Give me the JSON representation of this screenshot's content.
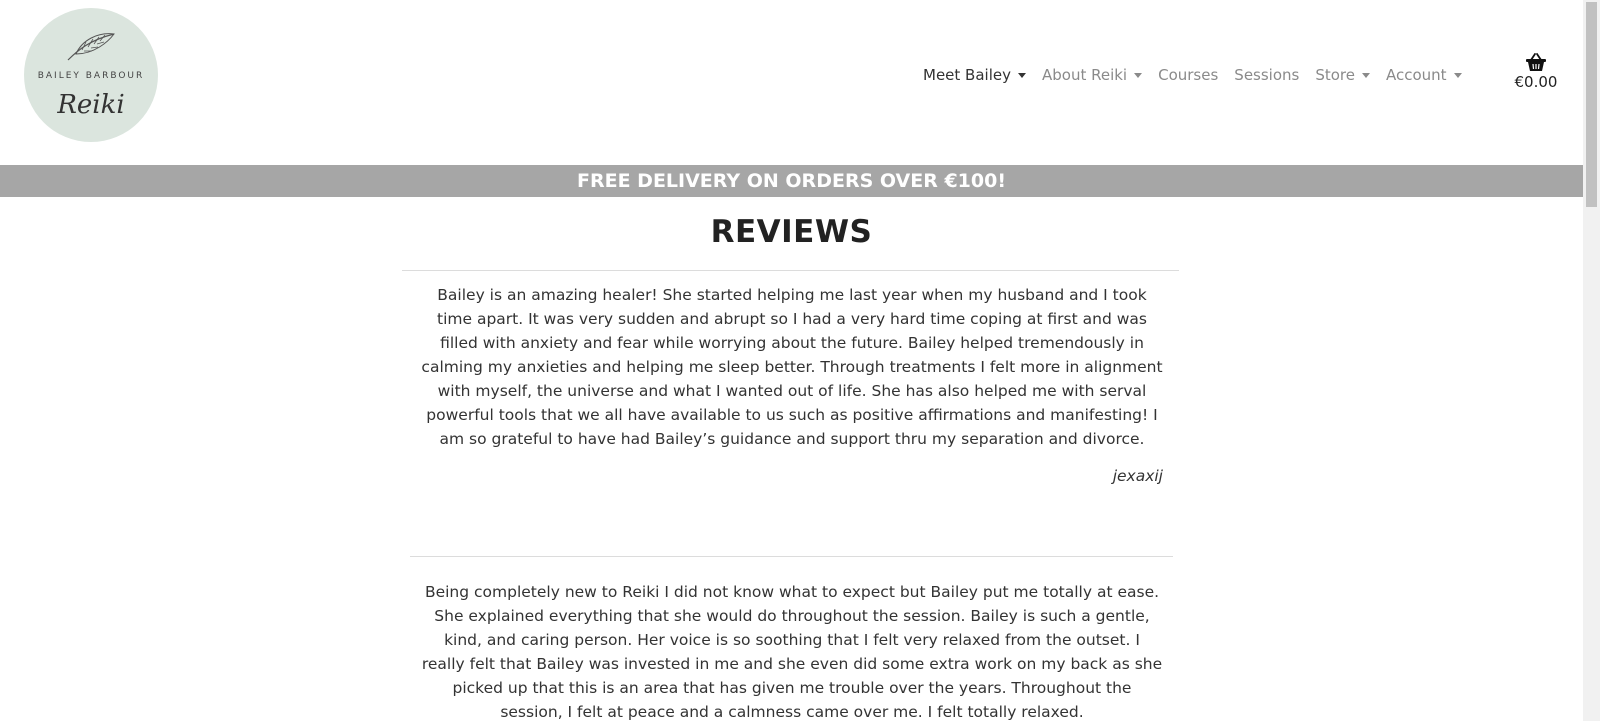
{
  "logo": {
    "top_text": "BAILEY BARBOUR",
    "script_text": "Reiki"
  },
  "nav": {
    "items": [
      {
        "label": "Meet Bailey",
        "dropdown": true,
        "active": true
      },
      {
        "label": "About Reiki",
        "dropdown": true,
        "active": false
      },
      {
        "label": "Courses",
        "dropdown": false,
        "active": false
      },
      {
        "label": "Sessions",
        "dropdown": false,
        "active": false
      },
      {
        "label": "Store",
        "dropdown": true,
        "active": false
      },
      {
        "label": "Account",
        "dropdown": true,
        "active": false
      }
    ]
  },
  "cart": {
    "icon": "basket-icon",
    "total": "€0.00"
  },
  "banner": {
    "text": "FREE DELIVERY ON ORDERS OVER €100!"
  },
  "page": {
    "title": "REVIEWS"
  },
  "reviews": [
    {
      "text": "Bailey is an amazing healer! She started helping me last year when my husband and I took time apart. It was very sudden and abrupt so I had a very hard time coping at first and was filled with anxiety and fear while worrying about the future. Bailey helped tremendously in calming my anxieties and helping me sleep better. Through treatments I felt more in alignment with myself, the universe and what I wanted out of life. She has also helped me with serval powerful tools that we all have available to us such as positive affirmations and manifesting! I am so grateful to have had Bailey’s guidance and support thru my separation and divorce.",
      "author": "jexaxij"
    },
    {
      "text": "Being completely new to Reiki I did not know what to expect but Bailey put me totally at ease. She explained everything that she would do throughout the session. Bailey is such a gentle, kind, and caring person. Her voice is so soothing that I felt very relaxed from the outset. I really felt that Bailey was invested in me and she even did some extra work on my back as she picked up that this is an area that has given me trouble over the years. Throughout the session, I felt at peace and a calmness came over me. I felt totally relaxed."
    }
  ],
  "colors": {
    "banner_bg": "#a6a6a6",
    "logo_bg": "#dbe5de",
    "nav_active": "#333333",
    "nav_inactive": "#8a8a8a"
  }
}
